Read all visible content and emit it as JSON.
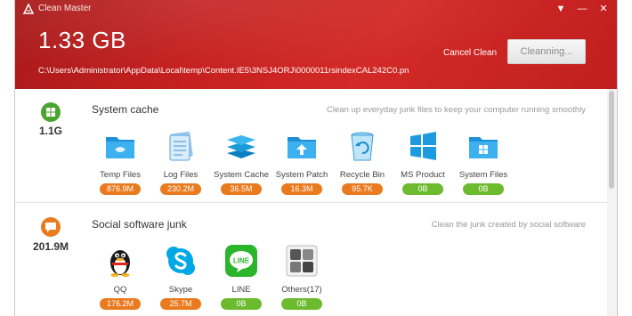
{
  "app": {
    "title": "Clean Master"
  },
  "titlebar": {
    "menu_glyph": "▼",
    "minimize_glyph": "—",
    "close_glyph": "✕"
  },
  "scan": {
    "total_size": "1.33 GB",
    "current_path": "C:\\Users\\Administrator\\AppData\\Local\\temp\\Content.IE5\\3NSJ4ORJ\\0000011rsindexCAL242C0.pn",
    "cancel_label": "Cancel Clean",
    "progress_label": "Cleanning..."
  },
  "sections": [
    {
      "title": "System cache",
      "size": "1.1G",
      "description": "Clean up everyday junk files to keep your computer running smoothly",
      "icon": "windows-icon",
      "icon_color": "#4aa52e",
      "items": [
        {
          "label": "Temp Files",
          "size": "876.9M",
          "status": "orange",
          "icon": "folder-icon"
        },
        {
          "label": "Log Files",
          "size": "230.2M",
          "status": "orange",
          "icon": "log-files-icon"
        },
        {
          "label": "System Cache",
          "size": "36.5M",
          "status": "orange",
          "icon": "stack-icon"
        },
        {
          "label": "System Patch",
          "size": "16.3M",
          "status": "orange",
          "icon": "folder-up-icon"
        },
        {
          "label": "Recycle Bin",
          "size": "95.7K",
          "status": "orange",
          "icon": "recycle-bin-icon"
        },
        {
          "label": "MS Product",
          "size": "0B",
          "status": "green",
          "icon": "windows-logo-icon"
        },
        {
          "label": "System Files",
          "size": "0B",
          "status": "green",
          "icon": "folder-windows-icon"
        }
      ]
    },
    {
      "title": "Social software junk",
      "size": "201.9M",
      "description": "Clean the junk created by social software",
      "icon": "chat-bubble-icon",
      "icon_color": "#ea7a1e",
      "items": [
        {
          "label": "QQ",
          "size": "176.2M",
          "status": "orange",
          "icon": "qq-penguin-icon"
        },
        {
          "label": "Skype",
          "size": "25.7M",
          "status": "orange",
          "icon": "skype-icon"
        },
        {
          "label": "LINE",
          "size": "0B",
          "status": "green",
          "icon": "line-icon"
        },
        {
          "label": "Others(17)",
          "size": "0B",
          "status": "green",
          "icon": "others-grid-icon"
        }
      ]
    }
  ],
  "colors": {
    "header_red": "#c41f1f",
    "badge_orange": "#ea7a1e",
    "badge_green": "#6cbb2e"
  }
}
